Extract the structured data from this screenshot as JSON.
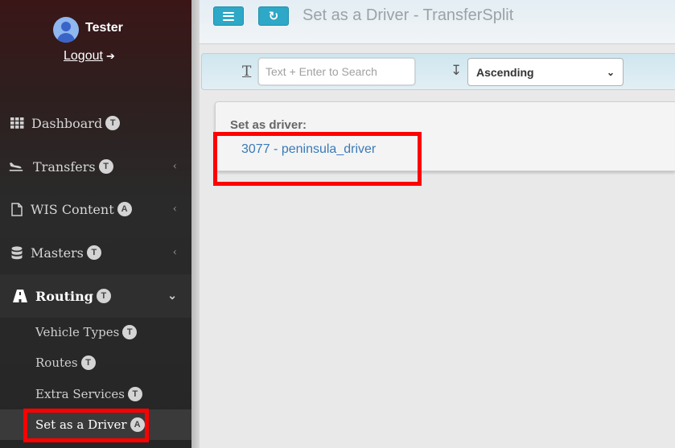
{
  "user": {
    "name": "Tester",
    "logout_label": "Logout"
  },
  "sidebar": {
    "items": [
      {
        "label": "Dashboard",
        "badge": "T",
        "icon": "grid-icon"
      },
      {
        "label": "Transfers",
        "badge": "T",
        "icon": "plane-landing-icon"
      },
      {
        "label": "WIS Content",
        "badge": "A",
        "icon": "file-icon"
      },
      {
        "label": "Masters",
        "badge": "T",
        "icon": "database-icon"
      },
      {
        "label": "Routing",
        "badge": "T",
        "icon": "road-icon"
      }
    ],
    "sub_items": [
      {
        "label": "Vehicle Types",
        "badge": "T"
      },
      {
        "label": "Routes",
        "badge": "T"
      },
      {
        "label": "Extra Services",
        "badge": "T"
      },
      {
        "label": "Set as a Driver",
        "badge": "A"
      }
    ]
  },
  "header": {
    "title": "Set as a Driver - TransferSplit"
  },
  "filter": {
    "search_placeholder": "Text + Enter to Search",
    "sort_value": "Ascending"
  },
  "content": {
    "label": "Set as driver:",
    "driver_link": "3077 - peninsula_driver"
  },
  "colors": {
    "accent_button": "#2ea8c7",
    "highlight": "#ff0000",
    "link": "#3a7ab8"
  }
}
